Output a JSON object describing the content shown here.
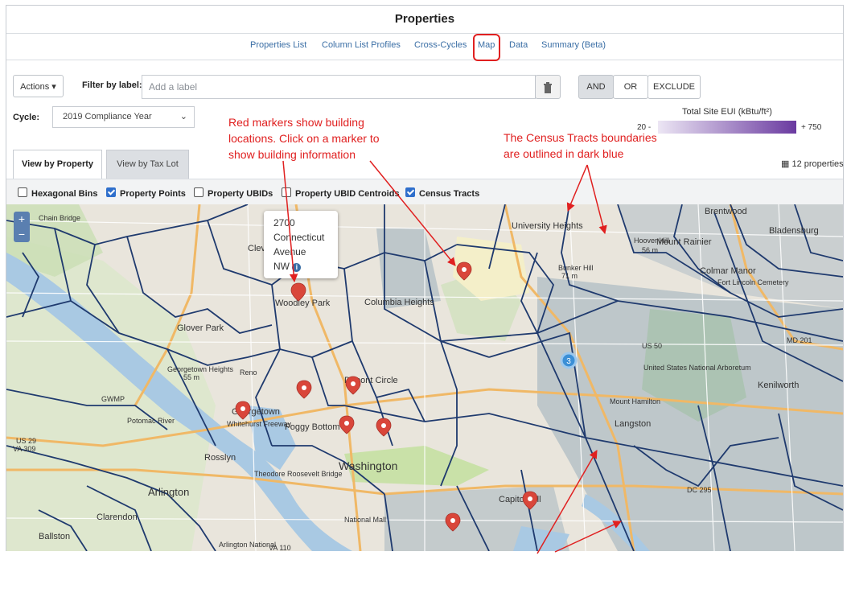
{
  "page_title": "Properties",
  "subnav": [
    "Properties List",
    "Column List Profiles",
    "Cross-Cycles",
    "Map",
    "Data",
    "Summary (Beta)"
  ],
  "toolbar": {
    "actions_label": "Actions",
    "filter_label": "Filter by label:",
    "filter_placeholder": "Add a label",
    "and_label": "AND",
    "or_label": "OR",
    "exclude_label": "EXCLUDE"
  },
  "cycle": {
    "label": "Cycle:",
    "value": "2019 Compliance Year"
  },
  "legend": {
    "title": "Total Site EUI (kBtu/ft²)",
    "min": "20 -",
    "max": "+ 750",
    "low_color": "#ece6f4",
    "high_color": "#6a3aa0"
  },
  "tabs": {
    "by_property": "View by Property",
    "by_taxlot": "View by Tax Lot"
  },
  "property_count": "12 properties",
  "layers": [
    {
      "label": "Hexagonal Bins",
      "checked": false
    },
    {
      "label": "Property Points",
      "checked": true
    },
    {
      "label": "Property UBIDs",
      "checked": false
    },
    {
      "label": "Property UBID Centroids",
      "checked": false
    },
    {
      "label": "Census Tracts",
      "checked": true
    }
  ],
  "popup": {
    "line1": "2700",
    "line2": "Connecticut",
    "line3": "Avenue",
    "line4": "NW"
  },
  "annotations": {
    "markers": [
      "Red markers show building",
      "locations. Click on a marker to",
      "show building information"
    ],
    "tracts": [
      "The Census Tracts boundaries",
      "are outlined in dark blue"
    ]
  },
  "zoom": {
    "in": "+",
    "out": "−"
  },
  "cluster_count": "3",
  "map_places": {
    "brentwood": "Brentwood",
    "bladensburg": "Bladensburg",
    "university_heights": "University Heights",
    "mount_rainier": "Mount Rainier",
    "hoover_hill": "Hoover Hill",
    "hoover_hill_elev": "56 m",
    "bunker_hill": "Bunker Hill",
    "bunker_hill_elev": "71 m",
    "colmar_manor": "Colmar Manor",
    "fort_lincoln": "Fort Lincoln Cemetery",
    "columbia_heights": "Columbia Heights",
    "woodley_park": "Woodley Park",
    "cleveland": "Clev",
    "glover_park": "Glover Park",
    "georgetown_heights": "Georgetown Heights",
    "georgetown_heights_elev": "55 m",
    "reno": "Reno",
    "dupont_circle": "Dupont Circle",
    "georgetown": "Georgetown",
    "foggy_bottom": "Foggy Bottom",
    "rosslyn": "Rosslyn",
    "washington": "Washington",
    "arlington": "Arlington",
    "clarendon": "Clarendon",
    "ballston": "Ballston",
    "capitol_hill": "Capitol Hill",
    "national_mall": "National Mall",
    "arboretum": "United States National Arboretum",
    "langston": "Langston",
    "mount_hamilton": "Mount Hamilton",
    "kenilworth": "Kenilworth",
    "theodore_roosevelt": "Theodore Roosevelt Bridge",
    "whitehurst": "Whitehurst Freeway",
    "arlington_cemetery": "Arlington National",
    "gwmp": "GWMP",
    "us29": "US 29",
    "va309": "VA 309",
    "us50": "US 50",
    "md201": "MD 201",
    "dc295": "DC 295",
    "va110": "VA 110",
    "potomac": "Potomac River",
    "chain_bridge": "Chain Bridge"
  },
  "colors": {
    "accent_red": "#e02020",
    "tract_blue": "#1f3a6e",
    "marker_red": "#d9463a",
    "link_blue": "#3a6ea5"
  }
}
